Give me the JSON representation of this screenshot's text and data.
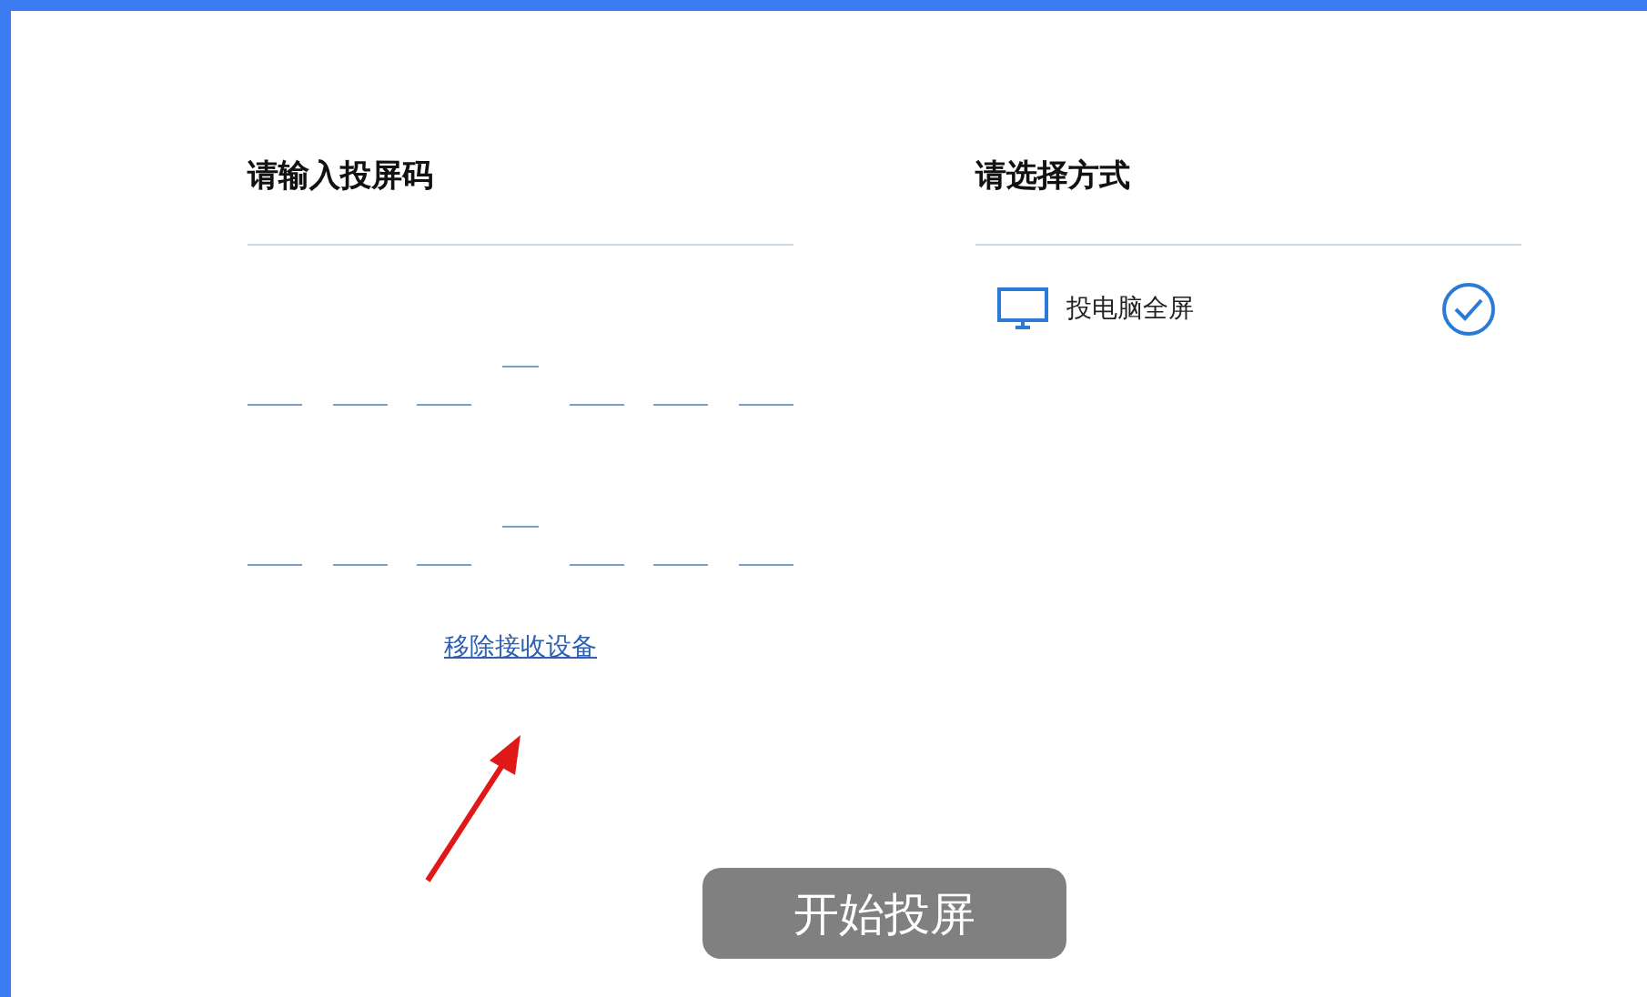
{
  "code_panel": {
    "title": "请输入投屏码",
    "link": "移除接收设备"
  },
  "mode_panel": {
    "title": "请选择方式",
    "options": [
      {
        "label": "投电脑全屏",
        "selected": true
      }
    ]
  },
  "start_button": "开始投屏"
}
